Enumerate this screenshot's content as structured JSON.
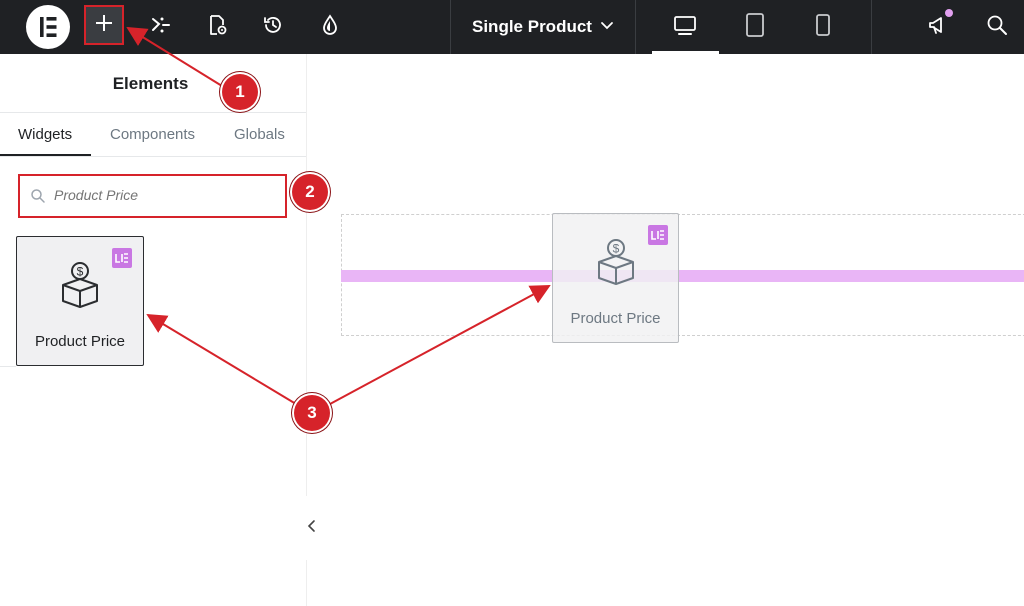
{
  "topbar": {
    "logo_icon": "elementor-logo-icon",
    "add_icon": "plus-icon",
    "structure_icon": "structure-icon",
    "page_settings_icon": "page-settings-icon",
    "history_icon": "history-icon",
    "site_settings_icon": "droplet-icon",
    "document_title": "Single Product",
    "devices": [
      "desktop-icon",
      "tablet-icon",
      "mobile-icon"
    ],
    "active_device": "desktop",
    "whats_new_icon": "megaphone-icon",
    "search_icon": "search-icon"
  },
  "panel": {
    "title": "Elements",
    "tabs": [
      {
        "label": "Widgets",
        "active": true
      },
      {
        "label": "Components",
        "active": false
      },
      {
        "label": "Globals",
        "active": false
      }
    ],
    "search": {
      "value": "",
      "placeholder": "Product Price"
    },
    "widgets": [
      {
        "label": "Product Price",
        "icon": "product-price-icon",
        "badge": "pro-badge-icon"
      }
    ]
  },
  "canvas": {
    "dragged_widget": {
      "label": "Product Price",
      "icon": "product-price-icon",
      "badge": "pro-badge-icon"
    },
    "collapse_icon": "chevron-left-icon"
  },
  "annotations": [
    "1",
    "2",
    "3"
  ],
  "colors": {
    "topbar_bg": "#1f2124",
    "highlight_red": "#d6232a",
    "drop_indicator": "#e9b5f6",
    "pro_badge": "#c977e3"
  }
}
